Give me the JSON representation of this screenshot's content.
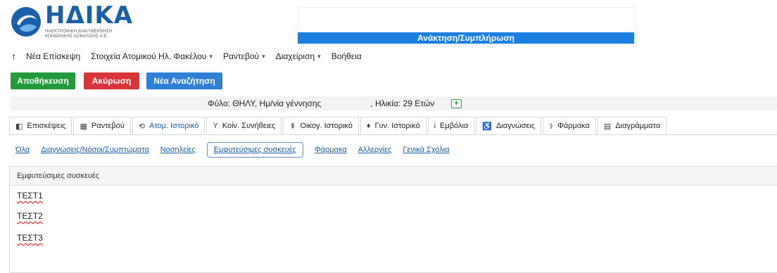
{
  "logo": {
    "name": "ΗΔΙΚΑ",
    "line1": "ΗΛΕΚΤΡΟΝΙΚΗ ΔΙΑΚΥΒΕΡΝΗΣΗ",
    "line2": "ΚΟΙΝΩΝΙΚΗΣ ΑΣΦΑΛΙΣΗΣ Α.Ε."
  },
  "header": {
    "title": "Ανάκτηση/Συμπλήρωση"
  },
  "menu": {
    "up_icon": "↑",
    "items": [
      "Νέα Επίσκεψη",
      "Στοιχεία Ατομικού Ηλ. Φακέλου",
      "Ραντεβού",
      "Διαχείριση",
      "Βοήθεια"
    ]
  },
  "buttons": {
    "save": "Αποθήκευση",
    "cancel": "Ακύρωση",
    "new_search": "Νέα Αναζήτηση"
  },
  "patient": {
    "gender": "Φύλο: ΘΗΛΥ,  Ημ/νία γέννησης",
    "age": ", Ηλικία: 29 Ετών"
  },
  "tabs": [
    {
      "icon": "◧",
      "label": "Επισκέψεις"
    },
    {
      "icon": "▦",
      "label": "Ραντεβού"
    },
    {
      "icon": "⟲",
      "label": "Ατομ. Ιστορικό"
    },
    {
      "icon": "Y",
      "label": "Κοίν. Συνήθειες"
    },
    {
      "icon": "⇞",
      "label": "Οικογ. Ιστορικό"
    },
    {
      "icon": "♦",
      "label": "Γυν. Ιστορικό"
    },
    {
      "icon": "i",
      "label": "Εμβόλια"
    },
    {
      "icon": "♿",
      "label": "Διαγνώσεις"
    },
    {
      "icon": "⚕",
      "label": "Φάρμακα"
    },
    {
      "icon": "▤",
      "label": "Διαγράμματα"
    }
  ],
  "subtabs": [
    "Όλα",
    "Διαγνώσεις/Νόσοι/Συμπτώματα",
    "Νοσηλείες",
    "Εμφυτεύσιμες συσκευές",
    "Φάρμακα",
    "Αλλεργίες",
    "Γενικά Σχόλια"
  ],
  "panel": {
    "title": "Εμφυτεύσιμες συσκευές",
    "entries": [
      "ΤΕΣΤ1",
      "ΤΕΣΤ2",
      "ΤΕΣΤ3"
    ]
  },
  "colors": {
    "brand": "#1a5fa8",
    "title_bar": "#1a7fe0",
    "save": "#229a3b",
    "cancel": "#d9343a",
    "new_search": "#2f7fd6"
  }
}
